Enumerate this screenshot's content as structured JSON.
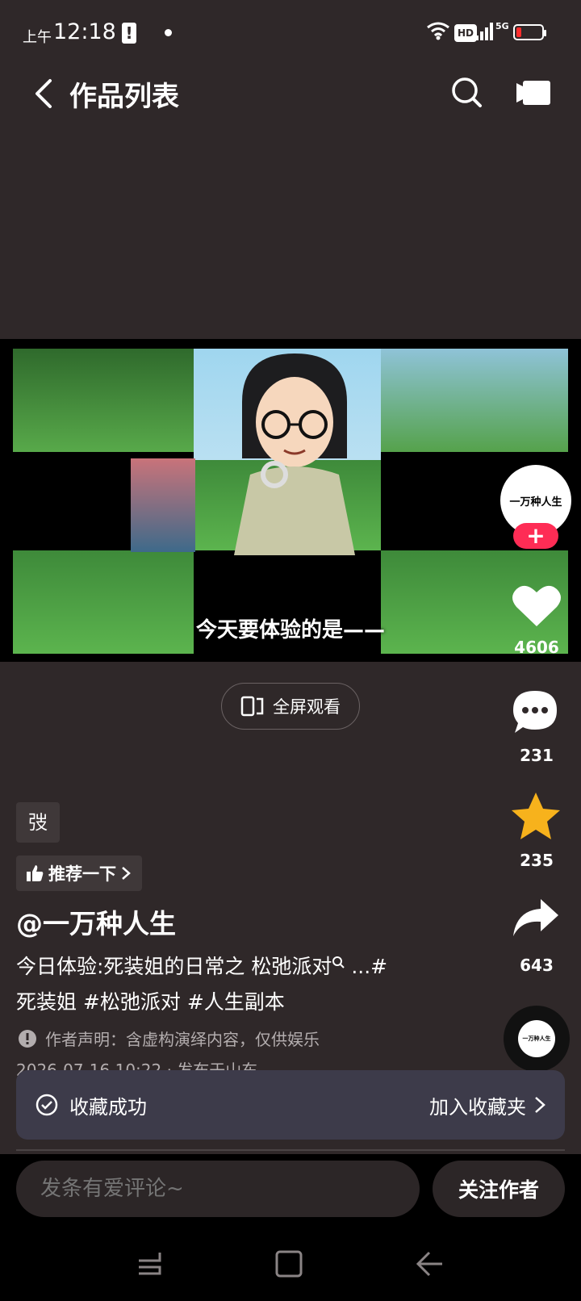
{
  "status_bar": {
    "time_prefix": "上午",
    "time": "12:18",
    "network": "5G",
    "hd": "HD",
    "colors": {
      "battery_low": "#ff2d2d"
    },
    "icons": [
      "alert-icon",
      "wifi-icon",
      "signal-icon",
      "battery-icon"
    ]
  },
  "header": {
    "title": "作品列表",
    "icons": [
      "back-icon",
      "search-icon",
      "camera-icon"
    ]
  },
  "video": {
    "subtitle": "今天要体验的是——"
  },
  "rail": {
    "avatar_text": "一万种人生",
    "follow_plus": "+",
    "likes": "4606",
    "comments": "231",
    "favorites": "235",
    "shares": "643",
    "disc_text": "一万种人生",
    "colors": {
      "follow": "#fe2c55",
      "favorite": "#f7b21c"
    }
  },
  "fullscreen": {
    "label": "全屏观看"
  },
  "meta": {
    "tag_chip": "弢",
    "recommend": "推荐一下",
    "author": "@一万种人生",
    "desc_line1": "今日体验:死装姐的日常之 松弛派对",
    "desc_more": " ...#",
    "desc_line2": "死装姐 #松弛派对 #人生副本",
    "declaration": "作者声明：含虚构演绎内容，仅供娱乐",
    "date": "2026-07-16 10:22 · 发布于山东"
  },
  "toast": {
    "message": "收藏成功",
    "action": "加入收藏夹"
  },
  "bottom": {
    "comment_placeholder": "发条有爱评论~",
    "follow_author": "关注作者"
  },
  "nav": [
    "recent-apps-icon",
    "home-icon",
    "back-nav-icon"
  ]
}
